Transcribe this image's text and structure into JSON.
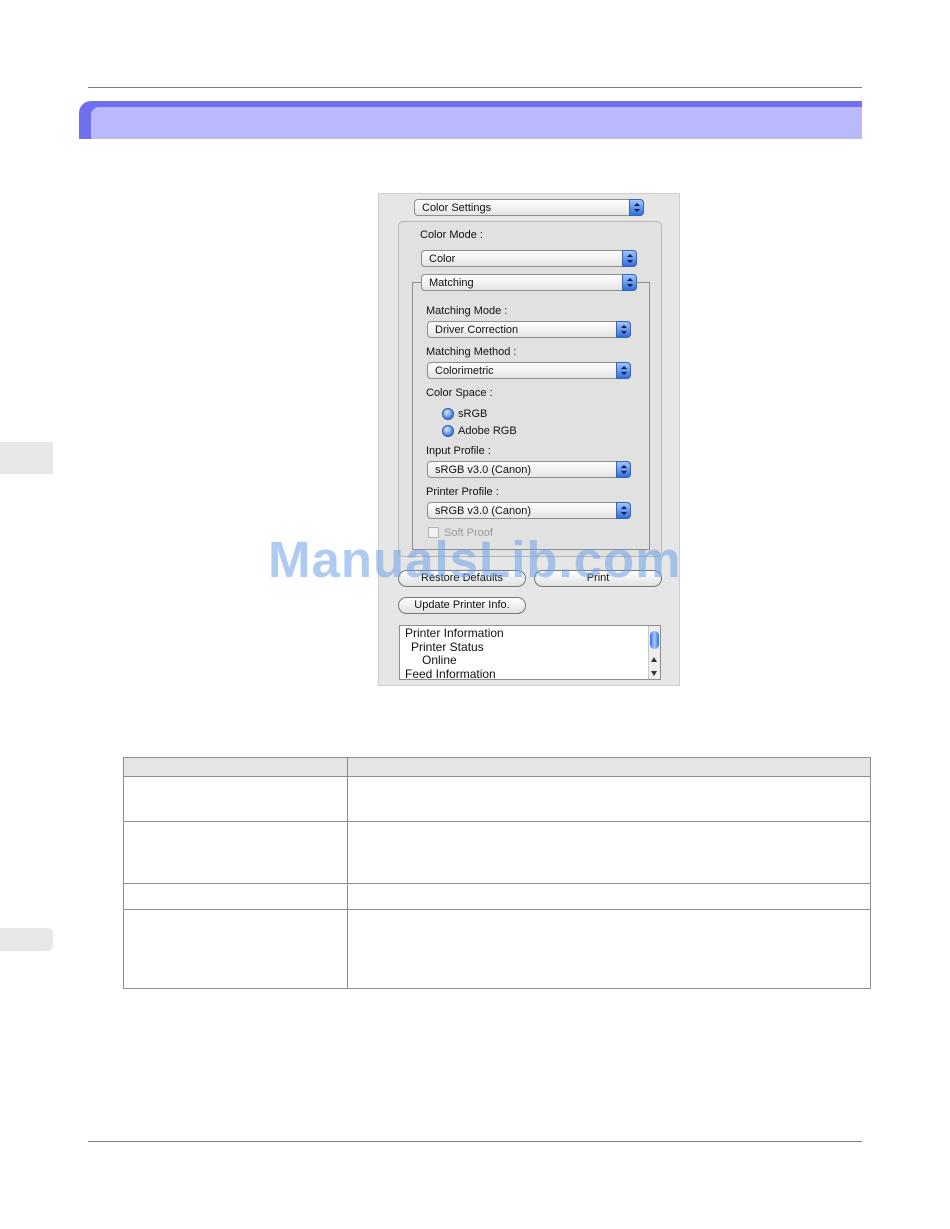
{
  "dialog": {
    "panel_popup": "Color Settings",
    "color_mode_label": "Color Mode :",
    "color_mode_value": "Color",
    "section_popup": "Matching",
    "matching_mode_label": "Matching Mode :",
    "matching_mode_value": "Driver Correction",
    "matching_method_label": "Matching Method :",
    "matching_method_value": "Colorimetric",
    "color_space_label": "Color Space :",
    "color_space_options": [
      "sRGB",
      "Adobe RGB"
    ],
    "input_profile_label": "Input Profile :",
    "input_profile_value": "sRGB v3.0 (Canon)",
    "printer_profile_label": "Printer Profile :",
    "printer_profile_value": "sRGB v3.0 (Canon)",
    "soft_proof_label": "Soft Proof",
    "restore_defaults_button": "Restore Defaults",
    "print_button": "Print",
    "update_printer_info_button": "Update Printer Info.",
    "info_lines": [
      "Printer Information",
      "Printer Status",
      "Online",
      "Feed Information"
    ]
  },
  "watermark": "ManualsLib.com",
  "colors": {
    "banner_outer": "#6f6ff0",
    "banner_inner": "#b9b9fb",
    "popup_arrow": "#2f6fe0",
    "watermark": "#6ea0e6"
  }
}
